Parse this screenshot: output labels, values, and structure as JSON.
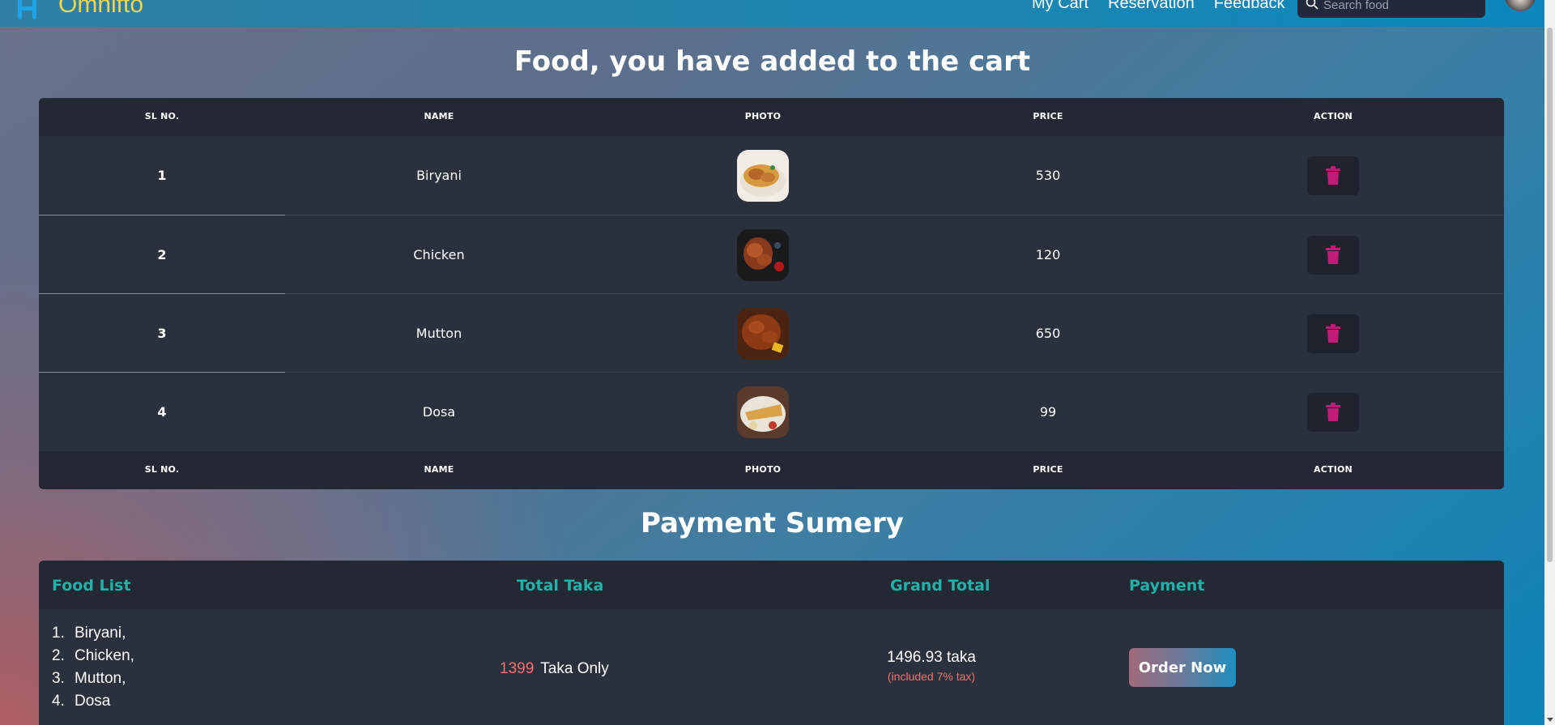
{
  "navbar": {
    "brand": "Omnifto",
    "links": [
      "My Cart",
      "Reservation",
      "Feedback"
    ],
    "search_placeholder": "Search food"
  },
  "cart": {
    "title": "Food, you have added to the cart",
    "columns": [
      "SL NO.",
      "NAME",
      "PHOTO",
      "PRICE",
      "ACTION"
    ],
    "rows": [
      {
        "sl": "1",
        "name": "Biryani",
        "price": "530"
      },
      {
        "sl": "2",
        "name": "Chicken",
        "price": "120"
      },
      {
        "sl": "3",
        "name": "Mutton",
        "price": "650"
      },
      {
        "sl": "4",
        "name": "Dosa",
        "price": "99"
      }
    ]
  },
  "payment": {
    "title": "Payment Sumery",
    "headers": {
      "food_list": "Food List",
      "total_taka": "Total Taka",
      "grand_total": "Grand Total",
      "payment": "Payment"
    },
    "food_list": [
      {
        "num": "1.",
        "name": "Biryani,"
      },
      {
        "num": "2.",
        "name": "Chicken,"
      },
      {
        "num": "3.",
        "name": "Mutton,"
      },
      {
        "num": "4.",
        "name": "Dosa"
      }
    ],
    "total_amount": "1399",
    "total_suffix": "Taka Only",
    "grand_total": "1496.93 taka",
    "tax_note": "(included 7% tax)",
    "order_button": "Order Now"
  },
  "colors": {
    "accent_teal": "#1fb2a6",
    "price_red": "#f87272",
    "brand_yellow": "#f6d64a",
    "delete_pink": "#c21c78",
    "panel": "#2a303c"
  },
  "icons": {
    "brand": "fork-knife-icon",
    "search": "search-icon",
    "delete": "trash-icon"
  }
}
